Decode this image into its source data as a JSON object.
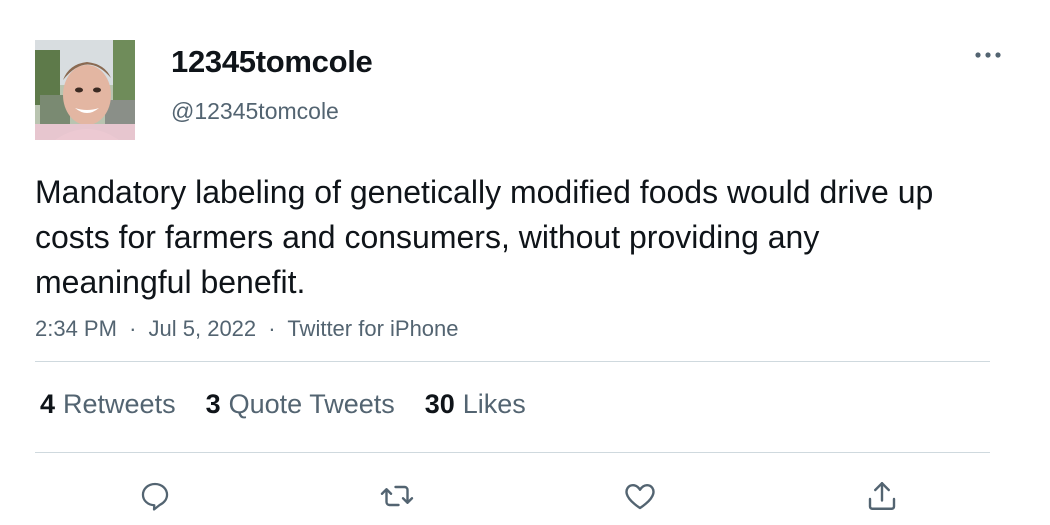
{
  "tweet": {
    "author": {
      "display_name": "12345tomcole",
      "handle": "@12345tomcole",
      "avatar_icon": "profile-photo"
    },
    "text": "Mandatory labeling of genetically modified foods would drive up costs for farmers and consumers, without providing any meaningful benefit.",
    "time": "2:34 PM",
    "date": "Jul 5, 2022",
    "source": "Twitter for iPhone",
    "separator": "·",
    "stats": [
      {
        "count": "4",
        "label": "Retweets"
      },
      {
        "count": "3",
        "label": "Quote Tweets"
      },
      {
        "count": "30",
        "label": "Likes"
      }
    ],
    "actions": [
      "reply-icon",
      "retweet-icon",
      "like-icon",
      "share-icon"
    ],
    "more_icon": "more-icon"
  },
  "colors": {
    "text_primary": "#0f1419",
    "text_secondary": "#536471",
    "divider": "#cfd9de"
  }
}
